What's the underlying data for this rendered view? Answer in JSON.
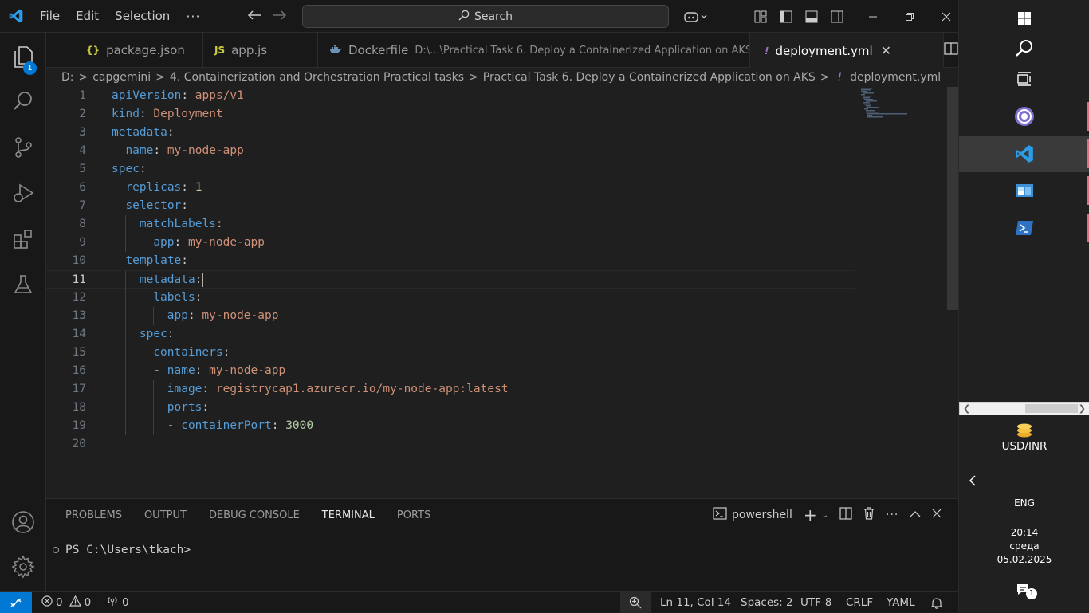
{
  "menu": {
    "file": "File",
    "edit": "Edit",
    "selection": "Selection",
    "more": "···"
  },
  "search": {
    "placeholder": "Search"
  },
  "activity": {
    "explorer_badge": "1"
  },
  "tabs": [
    {
      "icon_text": "{}",
      "label": "package.json",
      "description": ""
    },
    {
      "icon_text": "JS",
      "label": "app.js",
      "description": ""
    },
    {
      "icon_text": "",
      "label": "Dockerfile",
      "description": "D:\\...\\Practical Task 6. Deploy a Containerized Application on AKS"
    },
    {
      "icon_text": "!",
      "label": "deployment.yml",
      "description": "",
      "active": true
    }
  ],
  "breadcrumb": [
    "D:",
    "capgemini",
    "4. Containerization and Orchestration Practical tasks",
    "Practical Task 6. Deploy a Containerized Application on AKS",
    "deployment.yml"
  ],
  "editor": {
    "current_line": 11,
    "lines": [
      {
        "n": "1",
        "indent": 0,
        "dash": "",
        "key": "apiVersion",
        "val": "apps/v1",
        "type": "str"
      },
      {
        "n": "2",
        "indent": 0,
        "dash": "",
        "key": "kind",
        "val": "Deployment",
        "type": "str"
      },
      {
        "n": "3",
        "indent": 0,
        "dash": "",
        "key": "metadata",
        "val": "",
        "type": "str"
      },
      {
        "n": "4",
        "indent": 1,
        "dash": "",
        "key": "name",
        "val": "my-node-app",
        "type": "str"
      },
      {
        "n": "5",
        "indent": 0,
        "dash": "",
        "key": "spec",
        "val": "",
        "type": "str"
      },
      {
        "n": "6",
        "indent": 1,
        "dash": "",
        "key": "replicas",
        "val": "1",
        "type": "num"
      },
      {
        "n": "7",
        "indent": 1,
        "dash": "",
        "key": "selector",
        "val": "",
        "type": "str"
      },
      {
        "n": "8",
        "indent": 2,
        "dash": "",
        "key": "matchLabels",
        "val": "",
        "type": "str"
      },
      {
        "n": "9",
        "indent": 3,
        "dash": "",
        "key": "app",
        "val": "my-node-app",
        "type": "str"
      },
      {
        "n": "10",
        "indent": 1,
        "dash": "",
        "key": "template",
        "val": "",
        "type": "str"
      },
      {
        "n": "11",
        "indent": 2,
        "dash": "",
        "key": "metadata",
        "val": "",
        "type": "str"
      },
      {
        "n": "12",
        "indent": 3,
        "dash": "",
        "key": "labels",
        "val": "",
        "type": "str"
      },
      {
        "n": "13",
        "indent": 4,
        "dash": "",
        "key": "app",
        "val": "my-node-app",
        "type": "str"
      },
      {
        "n": "14",
        "indent": 2,
        "dash": "",
        "key": "spec",
        "val": "",
        "type": "str"
      },
      {
        "n": "15",
        "indent": 3,
        "dash": "",
        "key": "containers",
        "val": "",
        "type": "str"
      },
      {
        "n": "16",
        "indent": 3,
        "dash": "- ",
        "key": "name",
        "val": "my-node-app",
        "type": "str"
      },
      {
        "n": "17",
        "indent": 4,
        "dash": "",
        "key": "image",
        "val": "registrycap1.azurecr.io/my-node-app:latest",
        "type": "str"
      },
      {
        "n": "18",
        "indent": 4,
        "dash": "",
        "key": "ports",
        "val": "",
        "type": "str"
      },
      {
        "n": "19",
        "indent": 4,
        "dash": "- ",
        "key": "containerPort",
        "val": "3000",
        "type": "num"
      },
      {
        "n": "20",
        "indent": 0,
        "dash": "",
        "key": "",
        "val": "",
        "type": "str"
      }
    ]
  },
  "panel": {
    "tabs": [
      "PROBLEMS",
      "OUTPUT",
      "DEBUG CONSOLE",
      "TERMINAL",
      "PORTS"
    ],
    "active_tab": "TERMINAL",
    "shell": "powershell",
    "terminal_prompt": "PS C:\\Users\\tkach>"
  },
  "status": {
    "errors": "0",
    "warnings": "0",
    "ports": "0",
    "position": "Ln 11, Col 14",
    "spaces": "Spaces: 2",
    "encoding": "UTF-8",
    "eol": "CRLF",
    "language": "YAML"
  },
  "taskbar": {
    "widget_label": "USD/INR",
    "language": "ENG",
    "time": "20:14",
    "day": "среда",
    "date": "05.02.2025",
    "notification_count": "1"
  },
  "colors": {
    "accent": "#0078d4",
    "key": "#569cd6",
    "string": "#ce9178",
    "number": "#b5cea8"
  }
}
